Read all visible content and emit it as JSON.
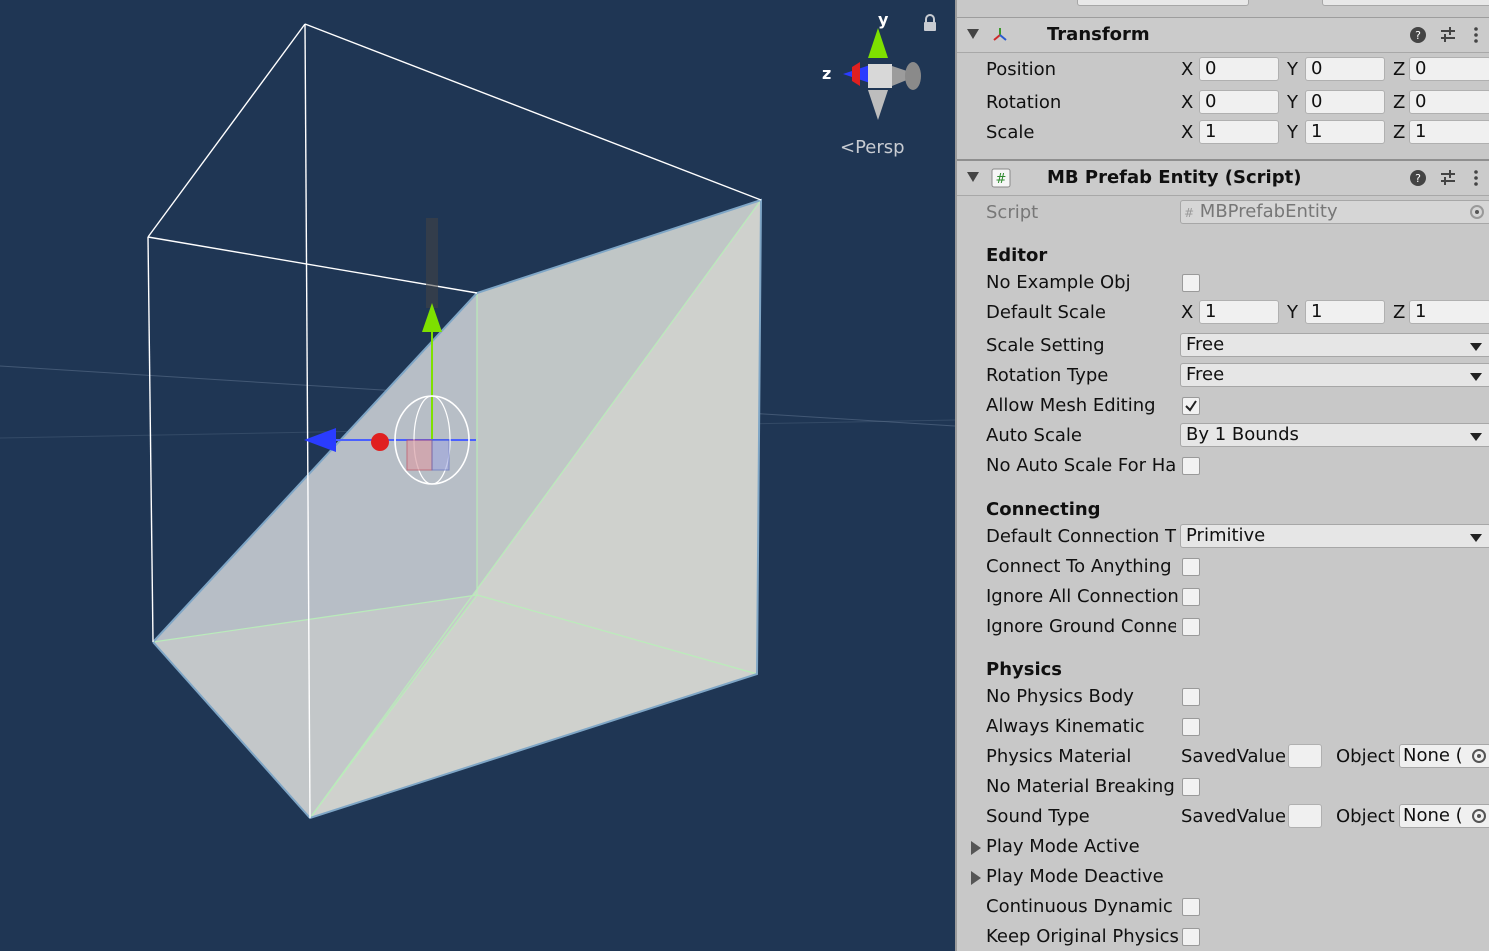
{
  "scene_view": {
    "projection_label": "Persp",
    "axis_labels": {
      "y": "y",
      "z": "z"
    },
    "icons": [
      "scene-gizmo-icon",
      "lock-icon",
      "move-tool-icon"
    ]
  },
  "inspector": {
    "transform": {
      "title": "Transform",
      "rows": [
        {
          "label": "Position",
          "x": "0",
          "y": "0",
          "z": "0"
        },
        {
          "label": "Rotation",
          "x": "0",
          "y": "0",
          "z": "0"
        },
        {
          "label": "Scale",
          "x": "1",
          "y": "1",
          "z": "1"
        }
      ],
      "axis_x": "X",
      "axis_y": "Y",
      "axis_z": "Z"
    },
    "script_component": {
      "title": "MB Prefab Entity (Script)",
      "script_label": "Script",
      "script_value": "MBPrefabEntity",
      "sections": {
        "editor": "Editor",
        "connecting": "Connecting",
        "physics": "Physics"
      },
      "editor": {
        "no_example_obj": {
          "label": "No Example Obj",
          "checked": false
        },
        "default_scale": {
          "label": "Default Scale",
          "x": "1",
          "y": "1",
          "z": "1"
        },
        "scale_setting": {
          "label": "Scale Setting",
          "value": "Free"
        },
        "rotation_type": {
          "label": "Rotation Type",
          "value": "Free"
        },
        "allow_mesh_editing": {
          "label": "Allow Mesh Editing",
          "checked": true
        },
        "auto_scale": {
          "label": "Auto Scale",
          "value": "By 1 Bounds"
        },
        "no_auto_scale": {
          "label": "No Auto Scale For Ha",
          "checked": false
        }
      },
      "connecting": {
        "default_connection": {
          "label": "Default Connection T",
          "value": "Primitive"
        },
        "connect_to_anything": {
          "label": "Connect To Anything",
          "checked": false
        },
        "ignore_all_connection": {
          "label": "Ignore All Connection",
          "checked": false
        },
        "ignore_ground_conn": {
          "label": "Ignore Ground Conne",
          "checked": false
        }
      },
      "physics": {
        "no_physics_body": {
          "label": "No Physics Body",
          "checked": false
        },
        "always_kinematic": {
          "label": "Always Kinematic",
          "checked": false
        },
        "physics_material": {
          "label": "Physics Material",
          "saved_label": "SavedValue",
          "object_label": "Object",
          "object_value": "None ("
        },
        "no_material_breaking": {
          "label": "No Material Breaking",
          "checked": false
        },
        "sound_type": {
          "label": "Sound Type",
          "saved_label": "SavedValue",
          "object_label": "Object",
          "object_value": "None ("
        },
        "play_mode_active": {
          "label": "Play Mode Active"
        },
        "play_mode_deactive": {
          "label": "Play Mode Deactive"
        },
        "continuous_dynamic": {
          "label": "Continuous Dynamic",
          "checked": false
        },
        "keep_original_physics": {
          "label": "Keep Original Physics",
          "checked": false
        }
      }
    }
  },
  "colors": {
    "scene_bg": "#1f3654",
    "inspector_bg": "#c8c8c8",
    "gizmo_y": "#7ee000",
    "gizmo_z": "#2a3cff",
    "gizmo_x": "#e02020"
  }
}
